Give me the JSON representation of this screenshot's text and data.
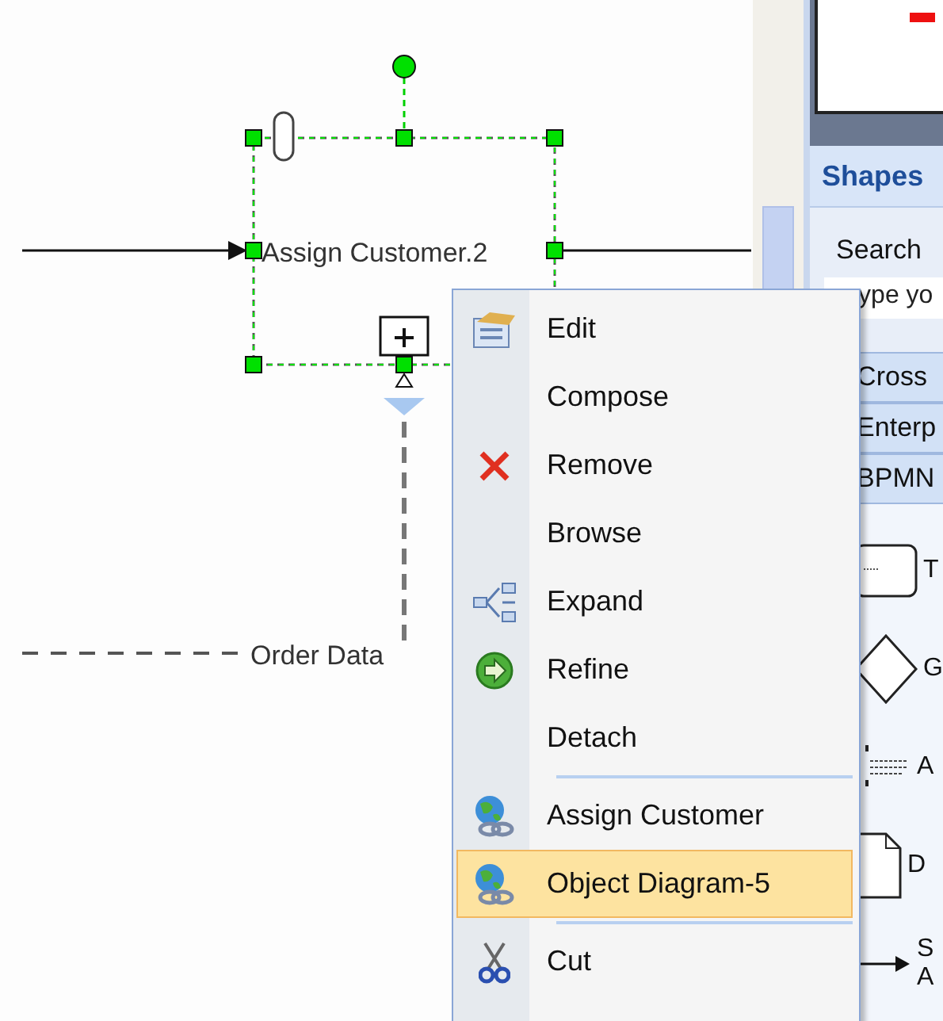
{
  "diagram": {
    "task_label": "Assign Customer.2",
    "data_label": "Order Data"
  },
  "panel": {
    "title": "Shapes",
    "search_label": "Search",
    "search_value": "ype yo",
    "categories": [
      "Cross",
      "Enterp",
      "BPMN"
    ],
    "shapes": [
      {
        "kind": "task",
        "lines": [
          "T"
        ]
      },
      {
        "kind": "gateway",
        "lines": [
          "G"
        ]
      },
      {
        "kind": "annotation",
        "lines": [
          "A"
        ]
      },
      {
        "kind": "document",
        "lines": [
          "D"
        ]
      },
      {
        "kind": "flow",
        "lines": [
          "S",
          "A"
        ]
      }
    ]
  },
  "menu": [
    {
      "kind": "edit",
      "label": "Edit",
      "selected": false
    },
    {
      "kind": "plain",
      "label": "Compose",
      "selected": false
    },
    {
      "kind": "remove",
      "label": "Remove",
      "selected": false
    },
    {
      "kind": "plain",
      "label": "Browse",
      "selected": false
    },
    {
      "kind": "expand",
      "label": "Expand",
      "selected": false
    },
    {
      "kind": "refine",
      "label": "Refine",
      "selected": false
    },
    {
      "kind": "plain",
      "label": "Detach",
      "selected": false
    },
    {
      "kind": "separator"
    },
    {
      "kind": "link",
      "label": "Assign Customer",
      "selected": false
    },
    {
      "kind": "link",
      "label": "Object Diagram-5",
      "selected": true
    },
    {
      "kind": "separator"
    },
    {
      "kind": "cut",
      "label": "Cut",
      "selected": false
    }
  ]
}
